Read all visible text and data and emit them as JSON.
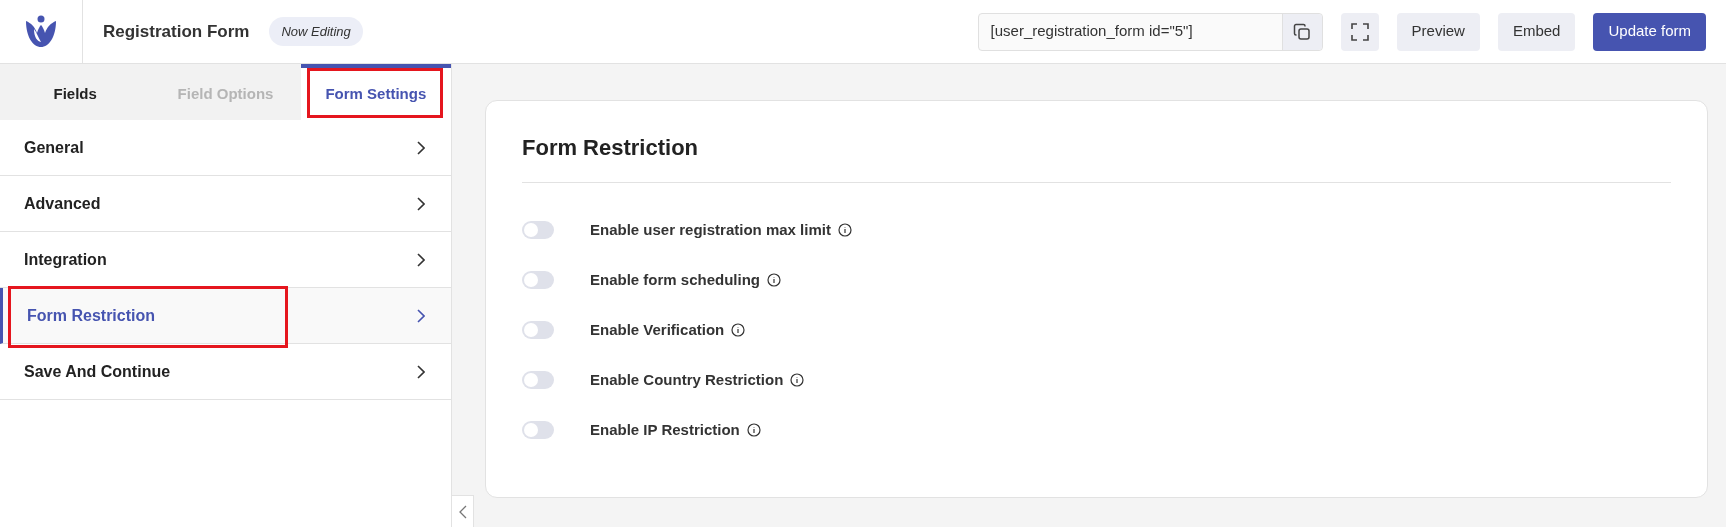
{
  "header": {
    "title": "Registration Form",
    "badge": "Now Editing",
    "shortcode": "[user_registration_form id=\"5\"]",
    "buttons": [
      {
        "label": "Preview",
        "kind": "secondary"
      },
      {
        "label": "Embed",
        "kind": "secondary"
      },
      {
        "label": "Update form",
        "kind": "primary"
      }
    ]
  },
  "tabs": [
    {
      "label": "Fields",
      "selected": false,
      "disabled": false,
      "highlighted": false
    },
    {
      "label": "Field Options",
      "selected": false,
      "disabled": true,
      "highlighted": false
    },
    {
      "label": "Form Settings",
      "selected": true,
      "disabled": false,
      "highlighted": true
    }
  ],
  "sidebar": {
    "items": [
      {
        "label": "General",
        "selected": false,
        "highlighted": false
      },
      {
        "label": "Advanced",
        "selected": false,
        "highlighted": false
      },
      {
        "label": "Integration",
        "selected": false,
        "highlighted": false
      },
      {
        "label": "Form Restriction",
        "selected": true,
        "highlighted": true
      },
      {
        "label": "Save And Continue",
        "selected": false,
        "highlighted": false
      }
    ]
  },
  "panel": {
    "title": "Form Restriction",
    "options": [
      {
        "label": "Enable user registration max limit",
        "on": false
      },
      {
        "label": "Enable form scheduling",
        "on": false
      },
      {
        "label": "Enable Verification",
        "on": false
      },
      {
        "label": "Enable Country Restriction",
        "on": false
      },
      {
        "label": "Enable IP Restriction",
        "on": false
      }
    ]
  }
}
